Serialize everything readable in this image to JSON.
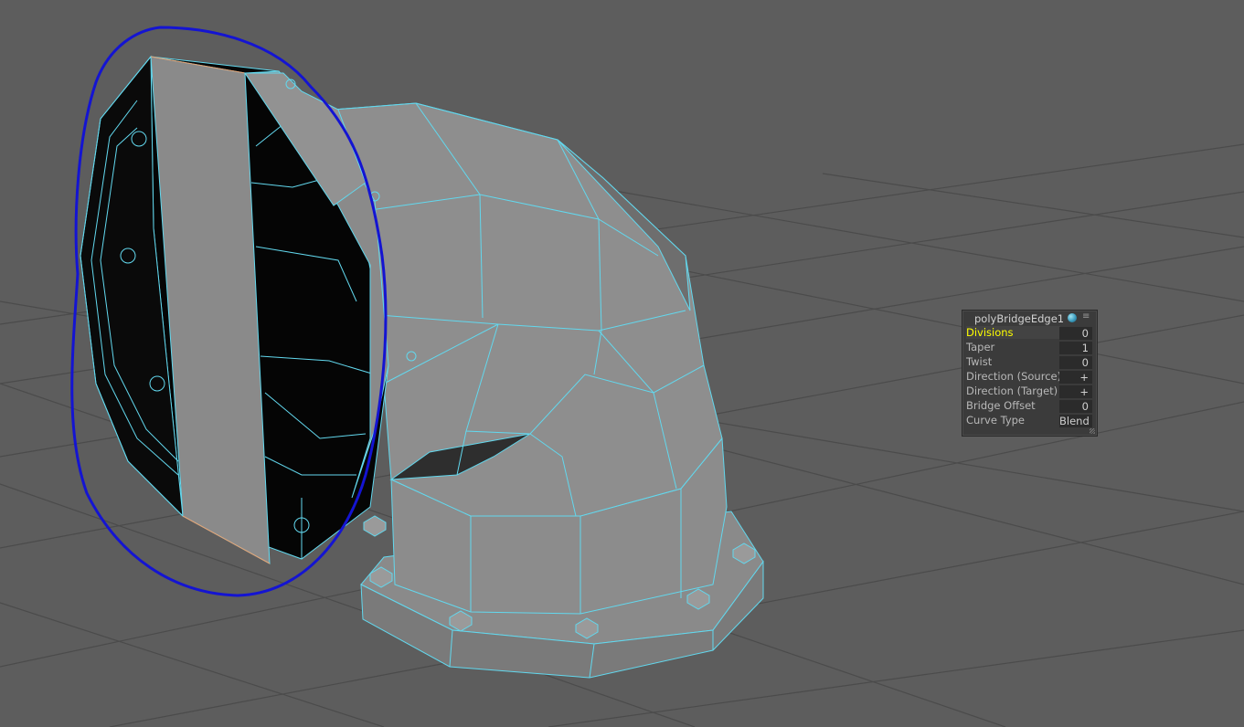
{
  "viewport": {
    "background": "#5d5d5d",
    "grid_color": "#4a4a4a",
    "wire_color": "#62d8ee",
    "lasso_color": "#1414d2",
    "selected_edge_color": "#e8a070",
    "object": "pipe-elbow-model"
  },
  "channel_box": {
    "title": "polyBridgeEdge1",
    "rows": [
      {
        "label": "Divisions",
        "value": "0",
        "selected": true
      },
      {
        "label": "Taper",
        "value": "1"
      },
      {
        "label": "Twist",
        "value": "0"
      },
      {
        "label": "Direction (Source)",
        "value": "+"
      },
      {
        "label": "Direction (Target)",
        "value": "+"
      },
      {
        "label": "Bridge Offset",
        "value": "0"
      },
      {
        "label": "Curve Type",
        "value": "Blend"
      }
    ]
  }
}
